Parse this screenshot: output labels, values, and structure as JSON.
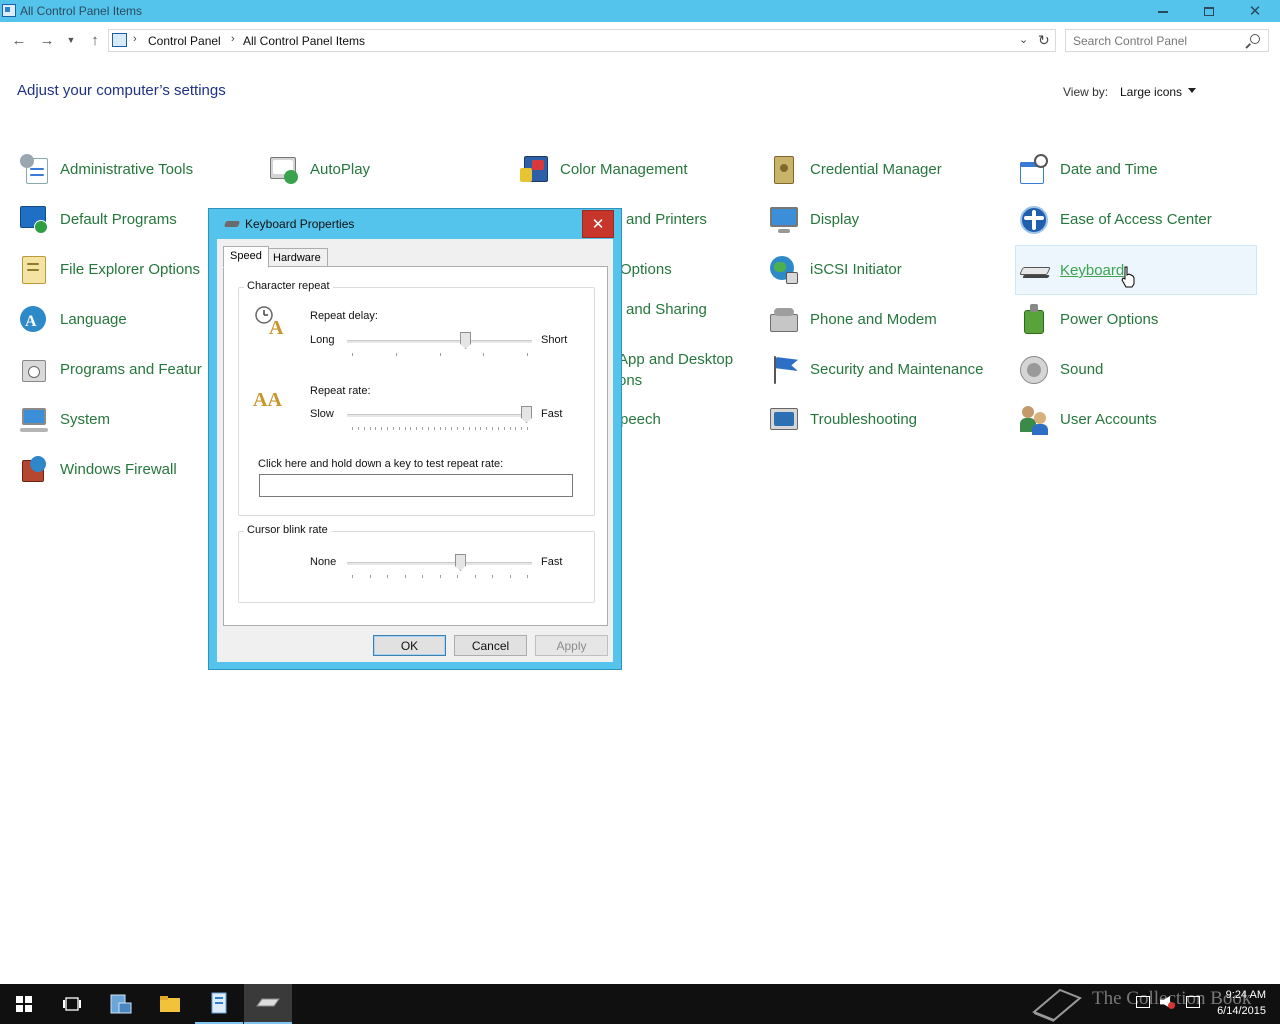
{
  "window": {
    "title": "All Control Panel Items",
    "minimize_label": "",
    "maximize_label": "",
    "close_label": "✕"
  },
  "address_bar": {
    "breadcrumbs": [
      "Control Panel",
      "All Control Panel Items"
    ],
    "search_placeholder": "Search Control Panel"
  },
  "content": {
    "heading": "Adjust your computer’s settings",
    "view_by_label": "View by:",
    "view_by_value": "Large icons"
  },
  "items": [
    {
      "label": "Administrative Tools",
      "icon": "administrative-tools-icon"
    },
    {
      "label": "AutoPlay",
      "icon": "autoplay-icon"
    },
    {
      "label": "Color Management",
      "icon": "color-management-icon"
    },
    {
      "label": "Credential Manager",
      "icon": "credential-manager-icon"
    },
    {
      "label": "Date and Time",
      "icon": "date-and-time-icon"
    },
    {
      "label": "Default Programs",
      "icon": "default-programs-icon"
    },
    {
      "label": "and Printers",
      "icon": "devices-and-printers-icon"
    },
    {
      "label": "Display",
      "icon": "display-icon"
    },
    {
      "label": "Ease of Access Center",
      "icon": "ease-of-access-icon"
    },
    {
      "label": "File Explorer Options",
      "icon": "file-explorer-options-icon"
    },
    {
      "label": "Options",
      "icon": "folder-options-icon"
    },
    {
      "label": "iSCSI Initiator",
      "icon": "iscsi-initiator-icon"
    },
    {
      "label": "Keyboard",
      "icon": "keyboard-icon"
    },
    {
      "label": "Language",
      "icon": "language-icon"
    },
    {
      "label": "and Sharing",
      "icon": "network-sharing-icon"
    },
    {
      "label": "Phone and Modem",
      "icon": "phone-and-modem-icon"
    },
    {
      "label": "Power Options",
      "icon": "power-options-icon"
    },
    {
      "label": "Programs and Featur",
      "icon": "programs-and-features-icon"
    },
    {
      "label": "App and Desktop\nons",
      "icon": "remoteapp-icon"
    },
    {
      "label": "Security and Maintenance",
      "icon": "security-maintenance-icon"
    },
    {
      "label": "Sound",
      "icon": "sound-icon"
    },
    {
      "label": "System",
      "icon": "system-icon"
    },
    {
      "label": "peech",
      "icon": "speech-icon"
    },
    {
      "label": "Troubleshooting",
      "icon": "troubleshooting-icon"
    },
    {
      "label": "User Accounts",
      "icon": "user-accounts-icon"
    },
    {
      "label": "Windows Firewall",
      "icon": "windows-firewall-icon"
    }
  ],
  "dialog": {
    "title": "Keyboard Properties",
    "close_label": "✕",
    "tabs": [
      "Speed",
      "Hardware"
    ],
    "active_tab": "Speed",
    "character_repeat": {
      "group_label": "Character repeat",
      "repeat_delay_label": "Repeat delay:",
      "repeat_delay_min": "Long",
      "repeat_delay_max": "Short",
      "repeat_delay_value": 0.65,
      "repeat_rate_label": "Repeat rate:",
      "repeat_rate_min": "Slow",
      "repeat_rate_max": "Fast",
      "repeat_rate_value": 1.0,
      "test_label": "Click here and hold down a key to test repeat rate:",
      "test_value": ""
    },
    "cursor_blink": {
      "group_label": "Cursor blink rate",
      "min": "None",
      "max": "Fast",
      "value": 0.62
    },
    "buttons": {
      "ok": "OK",
      "cancel": "Cancel",
      "apply": "Apply"
    }
  },
  "taskbar": {
    "time": "9:24 AM",
    "date": "6/14/2015",
    "watermark": "The Collection Book"
  },
  "colors": {
    "titlebar": "#54c4ec",
    "link_green": "#26773c",
    "heading_blue": "#1e3287",
    "close_red": "#c8362b"
  }
}
